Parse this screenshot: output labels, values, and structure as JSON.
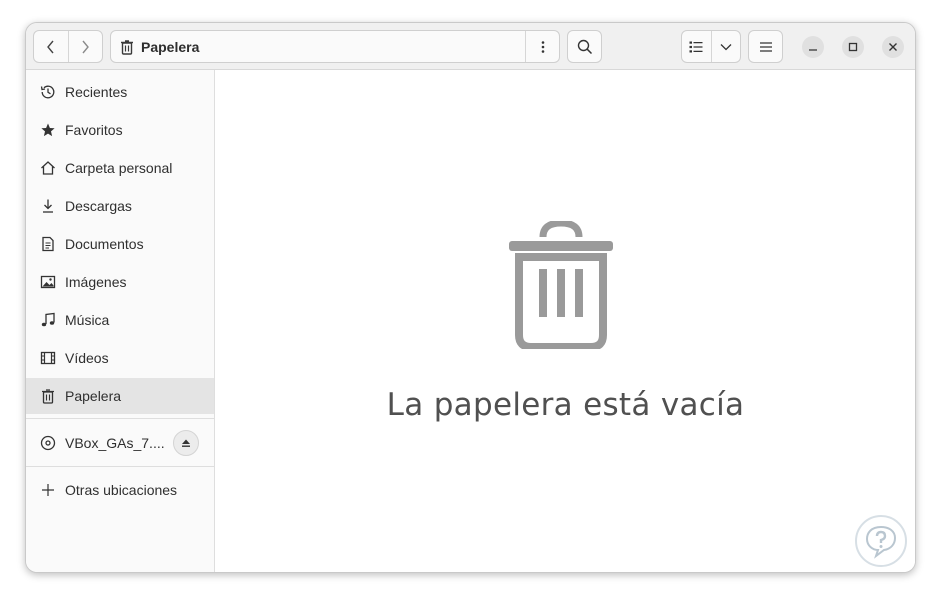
{
  "header": {
    "location": "Papelera",
    "back_icon": "chevron-left-icon",
    "forward_icon": "chevron-right-icon",
    "location_icon": "trash-icon",
    "path_menu_icon": "vertical-dots-icon",
    "search_icon": "search-icon",
    "view_icon": "list-view-icon",
    "view_dropdown_icon": "chevron-down-icon",
    "main_menu_icon": "hamburger-icon",
    "minimize_icon": "minimize-icon",
    "maximize_icon": "maximize-icon",
    "close_icon": "close-icon"
  },
  "sidebar": {
    "places": [
      {
        "label": "Recientes",
        "icon": "history-icon"
      },
      {
        "label": "Favoritos",
        "icon": "star-icon"
      },
      {
        "label": "Carpeta personal",
        "icon": "home-icon"
      },
      {
        "label": "Descargas",
        "icon": "download-icon"
      },
      {
        "label": "Documentos",
        "icon": "document-icon"
      },
      {
        "label": "Imágenes",
        "icon": "image-icon"
      },
      {
        "label": "Música",
        "icon": "music-icon"
      },
      {
        "label": "Vídeos",
        "icon": "video-icon"
      },
      {
        "label": "Papelera",
        "icon": "trash-icon",
        "active": true
      }
    ],
    "devices": [
      {
        "label": "VBox_GAs_7....",
        "icon": "disc-icon",
        "action_icon": "eject-icon"
      }
    ],
    "other": {
      "label": "Otras ubicaciones",
      "icon": "plus-icon"
    }
  },
  "main": {
    "empty_message": "La papelera está vacía",
    "empty_icon": "trash-large-icon"
  },
  "colors": {
    "accent_gray": "#9a9a9a",
    "active_row": "#e4e4e4"
  }
}
